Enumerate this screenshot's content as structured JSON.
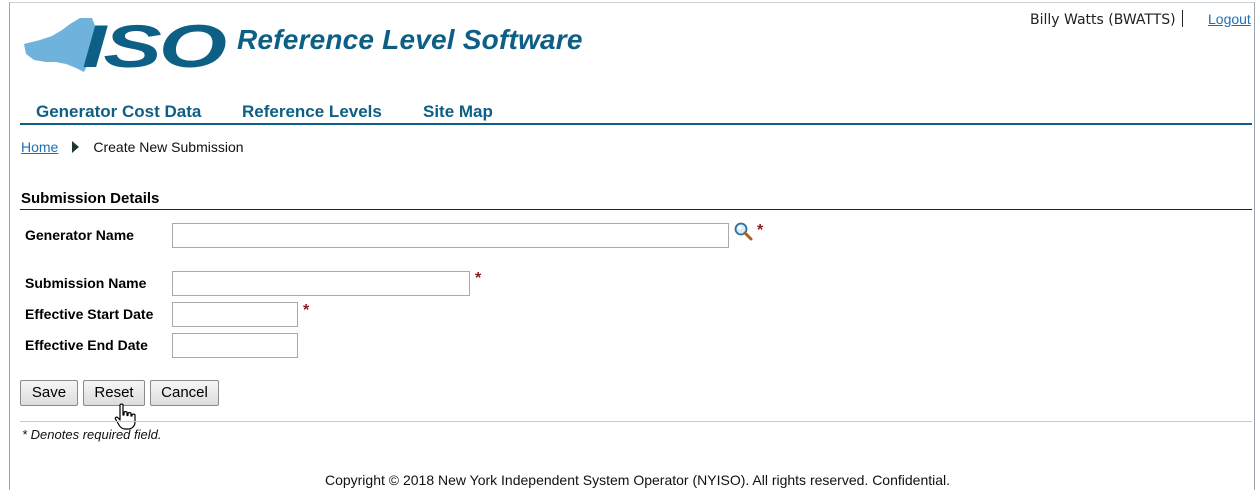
{
  "header": {
    "logo_text": "ISO",
    "app_title": "Reference Level Software",
    "user": "Billy Watts (BWATTS)",
    "logout": "Logout"
  },
  "nav": {
    "items": [
      {
        "label": "Generator Cost Data"
      },
      {
        "label": "Reference Levels"
      },
      {
        "label": "Site Map"
      }
    ]
  },
  "breadcrumb": {
    "home": "Home",
    "current": "Create New Submission"
  },
  "form": {
    "section_title": "Submission Details",
    "required_marker": "*",
    "fields": {
      "generator_name": {
        "label": "Generator Name",
        "value": ""
      },
      "submission_name": {
        "label": "Submission Name",
        "value": ""
      },
      "effective_start_date": {
        "label": "Effective Start Date",
        "value": ""
      },
      "effective_end_date": {
        "label": "Effective End Date",
        "value": ""
      }
    },
    "buttons": {
      "save": "Save",
      "reset": "Reset",
      "cancel": "Cancel"
    },
    "required_note": "* Denotes required field."
  },
  "footer": {
    "copyright": "Copyright © 2018 New York Independent System Operator (NYISO). All rights reserved. Confidential."
  },
  "colors": {
    "brand_blue": "#0d5f85",
    "logo_light_blue": "#6fb3dd",
    "link_blue": "#1f6fb3",
    "required_red": "#8b1a1a"
  }
}
